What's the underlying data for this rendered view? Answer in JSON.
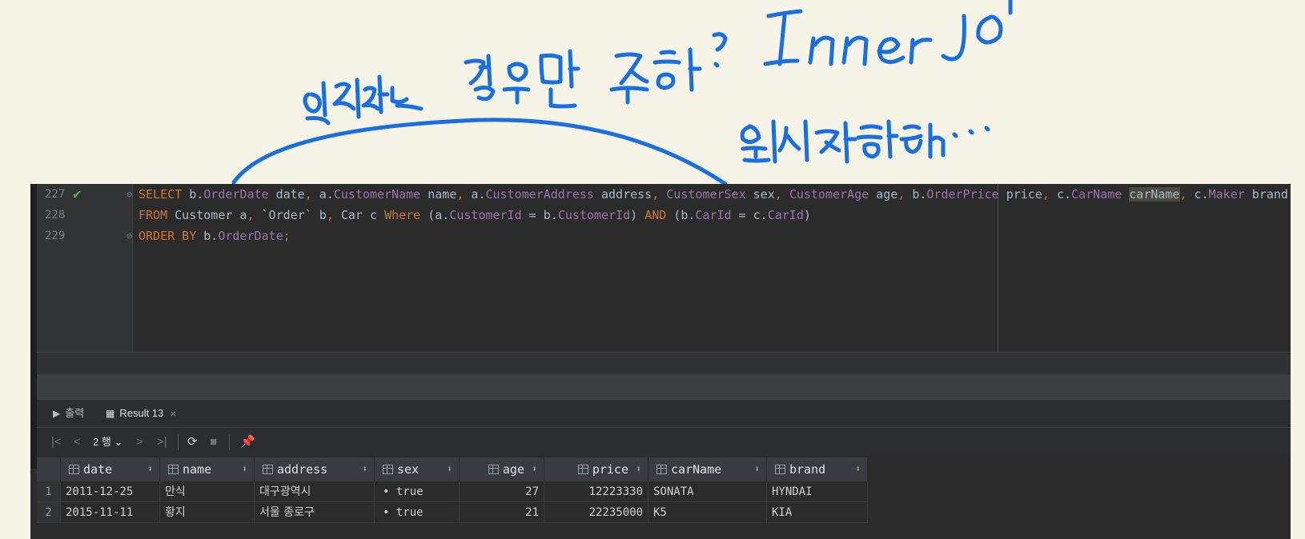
{
  "annotation": {
    "top_note": "일치하는 경우만 조회 : Inner Join",
    "sub_note": "원시적 형태..."
  },
  "editor": {
    "lines": [
      {
        "num": "227",
        "tokens": [
          {
            "t": "SELECT",
            "c": "kw"
          },
          {
            "t": " b.",
            "c": ""
          },
          {
            "t": "OrderDate",
            "c": "fd"
          },
          {
            "t": " date",
            "c": ""
          },
          {
            "t": ",",
            "c": "kw"
          },
          {
            "t": " a.",
            "c": ""
          },
          {
            "t": "CustomerName",
            "c": "fd"
          },
          {
            "t": " name",
            "c": ""
          },
          {
            "t": ",",
            "c": "kw"
          },
          {
            "t": " a.",
            "c": ""
          },
          {
            "t": "CustomerAddress",
            "c": "fd"
          },
          {
            "t": " address",
            "c": ""
          },
          {
            "t": ",",
            "c": "kw"
          },
          {
            "t": " ",
            "c": ""
          },
          {
            "t": "CustomerSex",
            "c": "fd"
          },
          {
            "t": " sex",
            "c": ""
          },
          {
            "t": ",",
            "c": "kw"
          },
          {
            "t": " ",
            "c": ""
          },
          {
            "t": "CustomerAge",
            "c": "fd"
          },
          {
            "t": " age",
            "c": ""
          },
          {
            "t": ",",
            "c": "kw"
          },
          {
            "t": " b.",
            "c": ""
          },
          {
            "t": "OrderPrice",
            "c": "fd"
          },
          {
            "t": " price",
            "c": ""
          },
          {
            "t": ",",
            "c": "kw"
          },
          {
            "t": " c.",
            "c": ""
          },
          {
            "t": "CarName",
            "c": "fd"
          },
          {
            "t": " ",
            "c": ""
          },
          {
            "t": "carName",
            "c": "hl"
          },
          {
            "t": ",",
            "c": "kw"
          },
          {
            "t": " c.",
            "c": ""
          },
          {
            "t": "Maker",
            "c": "fd"
          },
          {
            "t": " brand",
            "c": ""
          }
        ]
      },
      {
        "num": "228",
        "tokens": [
          {
            "t": "FROM",
            "c": "kw"
          },
          {
            "t": " Customer a",
            "c": ""
          },
          {
            "t": ",",
            "c": "kw"
          },
          {
            "t": " `Order` b",
            "c": ""
          },
          {
            "t": ",",
            "c": "kw"
          },
          {
            "t": " Car c ",
            "c": ""
          },
          {
            "t": "Where",
            "c": "kw"
          },
          {
            "t": " (a.",
            "c": ""
          },
          {
            "t": "CustomerId",
            "c": "fd"
          },
          {
            "t": " = b.",
            "c": ""
          },
          {
            "t": "CustomerId",
            "c": "fd"
          },
          {
            "t": ") ",
            "c": ""
          },
          {
            "t": "AND",
            "c": "kw"
          },
          {
            "t": " (b.",
            "c": ""
          },
          {
            "t": "CarId",
            "c": "fd"
          },
          {
            "t": " = c.",
            "c": ""
          },
          {
            "t": "CarId",
            "c": "fd"
          },
          {
            "t": ")",
            "c": ""
          }
        ]
      },
      {
        "num": "229",
        "tokens": [
          {
            "t": "ORDER BY",
            "c": "kw"
          },
          {
            "t": " b.",
            "c": ""
          },
          {
            "t": "OrderDate",
            "c": "fd"
          },
          {
            "t": ";",
            "c": "kw"
          }
        ]
      }
    ]
  },
  "tabs": [
    {
      "label": "출력",
      "icon": "output-icon"
    },
    {
      "label": "Result 13",
      "icon": "table-icon",
      "active": true
    }
  ],
  "toolbar": {
    "rows_label": "2 행"
  },
  "grid": {
    "columns": [
      "date",
      "name",
      "address",
      "sex",
      "age",
      "price",
      "carName",
      "brand"
    ],
    "rows": [
      {
        "n": "1",
        "date": "2011-12-25",
        "name": "만식",
        "address": "대구광역시",
        "sex": "• true",
        "age": "27",
        "price": "12223330",
        "carName": "SONATA",
        "brand": "HYNDAI"
      },
      {
        "n": "2",
        "date": "2015-11-11",
        "name": "황지",
        "address": "서울 종로구",
        "sex": "• true",
        "age": "21",
        "price": "22235000",
        "carName": "K5",
        "brand": "KIA"
      }
    ]
  },
  "colors": {
    "ink": "#1a6fe0",
    "keyword": "#cc7832",
    "field": "#9876aa",
    "check": "#5fb04f"
  }
}
